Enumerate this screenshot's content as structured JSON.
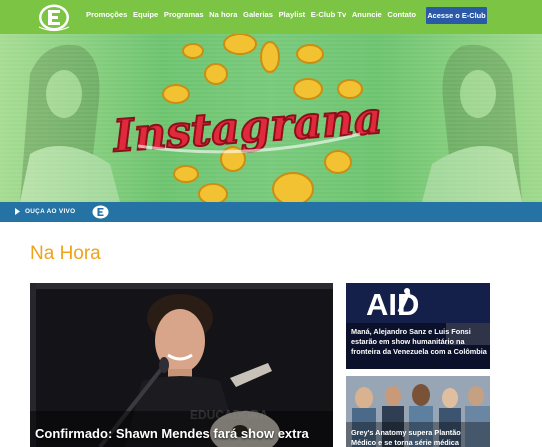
{
  "header": {
    "logo_alt": "E-Club",
    "nav": [
      "Promoções",
      "Equipe",
      "Programas",
      "Na hora",
      "Galerias",
      "Playlist",
      "E-Club Tv",
      "Anuncie",
      "Contato"
    ],
    "eclub_button": "Acesse o E-Club"
  },
  "banner": {
    "headline": "Instagrana",
    "slides": 6,
    "active_slide": 5
  },
  "listen_bar": {
    "label": "OUÇA AO VIVO"
  },
  "section": {
    "title": "Na Hora"
  },
  "news": [
    {
      "caption": "Confirmado: Shawn Mendes fará show extra"
    },
    {
      "caption": "Maná, Alejandro Sanz e Luis Fonsi estarão em show humanitário na fronteira da Venezuela com a Colômbia",
      "image_text": "AID"
    },
    {
      "caption": "Grey's Anatomy supera Plantão Médico e se torna série médica"
    }
  ],
  "colors": {
    "header_green": "#7cc444",
    "button_blue": "#2a5aa7",
    "listen_blue": "#2473a4",
    "title_orange": "#f0a21a"
  }
}
